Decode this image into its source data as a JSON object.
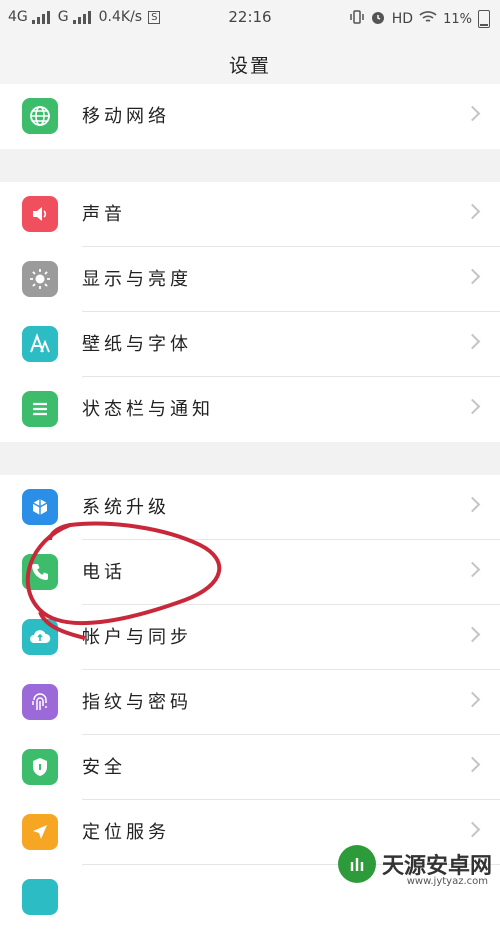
{
  "status": {
    "net1": "4G",
    "net2": "G",
    "speed": "0.4K/s",
    "s_badge": "S",
    "time": "22:16",
    "hd": "HD",
    "battery": "11%"
  },
  "header": {
    "title": "设置"
  },
  "groups": [
    {
      "items": [
        {
          "label": "移动网络",
          "icon": "globe-icon",
          "color": "#3dbd6b"
        }
      ]
    },
    {
      "items": [
        {
          "label": "声音",
          "icon": "speaker-icon",
          "color": "#f0505e"
        },
        {
          "label": "显示与亮度",
          "icon": "brightness-icon",
          "color": "#9b9b9b"
        },
        {
          "label": "壁纸与字体",
          "icon": "font-icon",
          "color": "#2cbcc4"
        },
        {
          "label": "状态栏与通知",
          "icon": "notification-list-icon",
          "color": "#3dbd6b"
        }
      ]
    },
    {
      "items": [
        {
          "label": "系统升级",
          "icon": "upgrade-icon",
          "color": "#2b8fe8"
        },
        {
          "label": "电话",
          "icon": "phone-icon",
          "color": "#3dbd6b"
        },
        {
          "label": "帐户与同步",
          "icon": "cloud-sync-icon",
          "color": "#2cbcc4"
        },
        {
          "label": "指纹与密码",
          "icon": "fingerprint-icon",
          "color": "#9b6ad8"
        },
        {
          "label": "安全",
          "icon": "shield-icon",
          "color": "#3dbd6b"
        },
        {
          "label": "定位服务",
          "icon": "location-arrow-icon",
          "color": "#f6a623"
        }
      ]
    }
  ],
  "watermark": {
    "text": "天源安卓网",
    "url": "www.jytyaz.com"
  }
}
